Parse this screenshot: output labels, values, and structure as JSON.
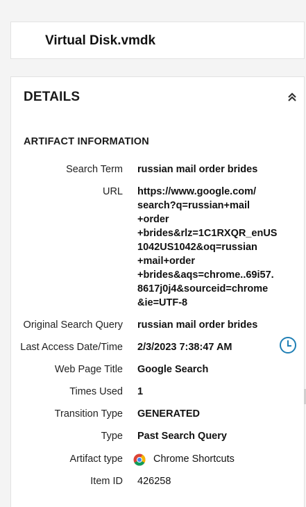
{
  "file": {
    "title": "Virtual Disk.vmdk"
  },
  "details": {
    "header": "DETAILS",
    "section_title": "ARTIFACT INFORMATION",
    "fields": {
      "search_term": {
        "label": "Search Term",
        "value": "russian mail order brides"
      },
      "url": {
        "label": "URL",
        "value": "https://www.google.com/\nsearch?q=russian+mail\n+order\n+brides&rlz=1C1RXQR_enUS\n1042US1042&oq=russian\n+mail+order\n+brides&aqs=chrome..69i57.\n8617j0j4&sourceid=chrome\n&ie=UTF-8"
      },
      "original_query": {
        "label": "Original Search Query",
        "value": "russian mail order brides"
      },
      "last_access": {
        "label": "Last Access Date/Time",
        "value": "2/3/2023 7:38:47 AM"
      },
      "page_title": {
        "label": "Web Page Title",
        "value": "Google Search"
      },
      "times_used": {
        "label": "Times Used",
        "value": "1"
      },
      "transition_type": {
        "label": "Transition Type",
        "value": "GENERATED"
      },
      "type": {
        "label": "Type",
        "value": "Past Search Query"
      },
      "artifact_type": {
        "label": "Artifact type",
        "value": "Chrome Shortcuts",
        "icon": "chrome-icon"
      },
      "item_id": {
        "label": "Item ID",
        "value": "426258"
      }
    }
  },
  "icons": {
    "collapse": "double-chevron-up-icon",
    "timeline": "clock-icon"
  },
  "colors": {
    "accent": "#1f7fb5"
  }
}
